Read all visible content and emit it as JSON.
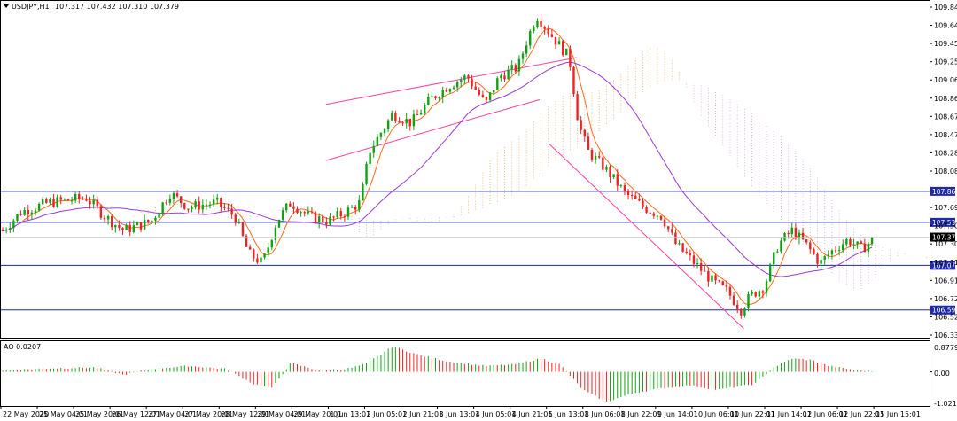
{
  "header": {
    "symbol": "USDJPY,H1",
    "ohlc": "107.317 107.432 107.310 107.379",
    "caret_icon": "triangle-down-icon"
  },
  "indicator": {
    "title": "AO 0.0207",
    "axis_top": "0.8779",
    "axis_zero": "0.00",
    "axis_bottom": "-1.021"
  },
  "chart_data": {
    "type": "candlestick",
    "symbol": "USDJPY",
    "timeframe": "H1",
    "ylim": [
      106.331,
      109.841
    ],
    "y_ticks": [
      109.841,
      109.646,
      109.451,
      109.256,
      109.061,
      108.866,
      108.671,
      108.476,
      108.281,
      108.086,
      107.696,
      107.501,
      107.306,
      107.111,
      106.916,
      106.721,
      106.526,
      106.331
    ],
    "y_tick_labels": [
      "109.841",
      "109.646",
      "109.451",
      "109.256",
      "109.061",
      "108.866",
      "108.671",
      "108.476",
      "108.281",
      "108.086",
      "107.696",
      "107.501",
      "107.306",
      "107.111",
      "106.916",
      "106.721",
      "106.526",
      "106.331"
    ],
    "x_labels": [
      "22 May 2020",
      "25 May 04:01",
      "25 May 20:01",
      "26 May 12:01",
      "27 May 04:01",
      "27 May 20:01",
      "28 May 12:01",
      "29 May 04:01",
      "29 May 20:01",
      "1 Jun 13:01",
      "2 Jun 05:01",
      "2 Jun 21:01",
      "3 Jun 13:01",
      "4 Jun 05:01",
      "4 Jun 21:01",
      "5 Jun 13:01",
      "8 Jun 06:01",
      "8 Jun 22:01",
      "9 Jun 14:01",
      "10 Jun 06:01",
      "10 Jun 22:01",
      "11 Jun 14:01",
      "12 Jun 06:01",
      "12 Jun 22:01",
      "15 Jun 15:01"
    ],
    "current_price": 107.379,
    "current_price_label": "107.379",
    "horizontal_levels": [
      {
        "value": 107.869,
        "label": "107.869"
      },
      {
        "value": 107.537,
        "label": "107.537"
      },
      {
        "value": 107.077,
        "label": "107.077"
      },
      {
        "value": 106.599,
        "label": "106.599"
      }
    ],
    "trend_channels": [
      {
        "from": [
          0.35,
          108.8
        ],
        "to": [
          0.62,
          109.3
        ]
      },
      {
        "from": [
          0.35,
          108.2
        ],
        "to": [
          0.58,
          108.85
        ]
      },
      {
        "from": [
          0.59,
          108.38
        ],
        "to": [
          0.8,
          106.4
        ]
      }
    ],
    "price_path": [
      [
        0.0,
        107.45
      ],
      [
        0.02,
        107.65
      ],
      [
        0.05,
        107.75
      ],
      [
        0.09,
        107.8
      ],
      [
        0.11,
        107.6
      ],
      [
        0.13,
        107.45
      ],
      [
        0.16,
        107.55
      ],
      [
        0.18,
        107.85
      ],
      [
        0.2,
        107.7
      ],
      [
        0.23,
        107.75
      ],
      [
        0.25,
        107.6
      ],
      [
        0.265,
        107.2
      ],
      [
        0.28,
        107.1
      ],
      [
        0.295,
        107.55
      ],
      [
        0.31,
        107.75
      ],
      [
        0.33,
        107.6
      ],
      [
        0.35,
        107.55
      ],
      [
        0.37,
        107.65
      ],
      [
        0.385,
        107.75
      ],
      [
        0.395,
        108.3
      ],
      [
        0.42,
        108.7
      ],
      [
        0.44,
        108.6
      ],
      [
        0.46,
        108.85
      ],
      [
        0.48,
        109.0
      ],
      [
        0.5,
        109.1
      ],
      [
        0.52,
        108.8
      ],
      [
        0.535,
        109.1
      ],
      [
        0.555,
        109.2
      ],
      [
        0.565,
        109.5
      ],
      [
        0.575,
        109.75
      ],
      [
        0.59,
        109.55
      ],
      [
        0.61,
        109.3
      ],
      [
        0.62,
        108.6
      ],
      [
        0.63,
        108.3
      ],
      [
        0.65,
        108.1
      ],
      [
        0.67,
        107.85
      ],
      [
        0.69,
        107.7
      ],
      [
        0.71,
        107.6
      ],
      [
        0.725,
        107.3
      ],
      [
        0.745,
        107.1
      ],
      [
        0.765,
        106.9
      ],
      [
        0.78,
        106.8
      ],
      [
        0.795,
        106.6
      ],
      [
        0.805,
        106.75
      ],
      [
        0.82,
        106.85
      ],
      [
        0.835,
        107.3
      ],
      [
        0.85,
        107.45
      ],
      [
        0.865,
        107.3
      ],
      [
        0.88,
        107.1
      ],
      [
        0.895,
        107.25
      ],
      [
        0.91,
        107.35
      ],
      [
        0.925,
        107.25
      ],
      [
        0.94,
        107.38
      ]
    ],
    "ao_path": [
      [
        0.0,
        0.05
      ],
      [
        0.05,
        0.12
      ],
      [
        0.1,
        0.15
      ],
      [
        0.13,
        -0.1
      ],
      [
        0.16,
        0.1
      ],
      [
        0.2,
        0.2
      ],
      [
        0.24,
        0.1
      ],
      [
        0.27,
        -0.4
      ],
      [
        0.29,
        -0.55
      ],
      [
        0.31,
        0.3
      ],
      [
        0.34,
        0.05
      ],
      [
        0.37,
        0.1
      ],
      [
        0.39,
        0.25
      ],
      [
        0.42,
        0.85
      ],
      [
        0.45,
        0.55
      ],
      [
        0.48,
        0.35
      ],
      [
        0.52,
        0.2
      ],
      [
        0.55,
        0.25
      ],
      [
        0.58,
        0.45
      ],
      [
        0.6,
        0.25
      ],
      [
        0.625,
        -0.6
      ],
      [
        0.65,
        -1.0
      ],
      [
        0.68,
        -0.7
      ],
      [
        0.71,
        -0.55
      ],
      [
        0.74,
        -0.45
      ],
      [
        0.77,
        -0.6
      ],
      [
        0.79,
        -0.5
      ],
      [
        0.81,
        -0.4
      ],
      [
        0.83,
        0.15
      ],
      [
        0.85,
        0.45
      ],
      [
        0.87,
        0.4
      ],
      [
        0.89,
        0.2
      ],
      [
        0.92,
        0.05
      ],
      [
        0.94,
        0.02
      ]
    ]
  }
}
